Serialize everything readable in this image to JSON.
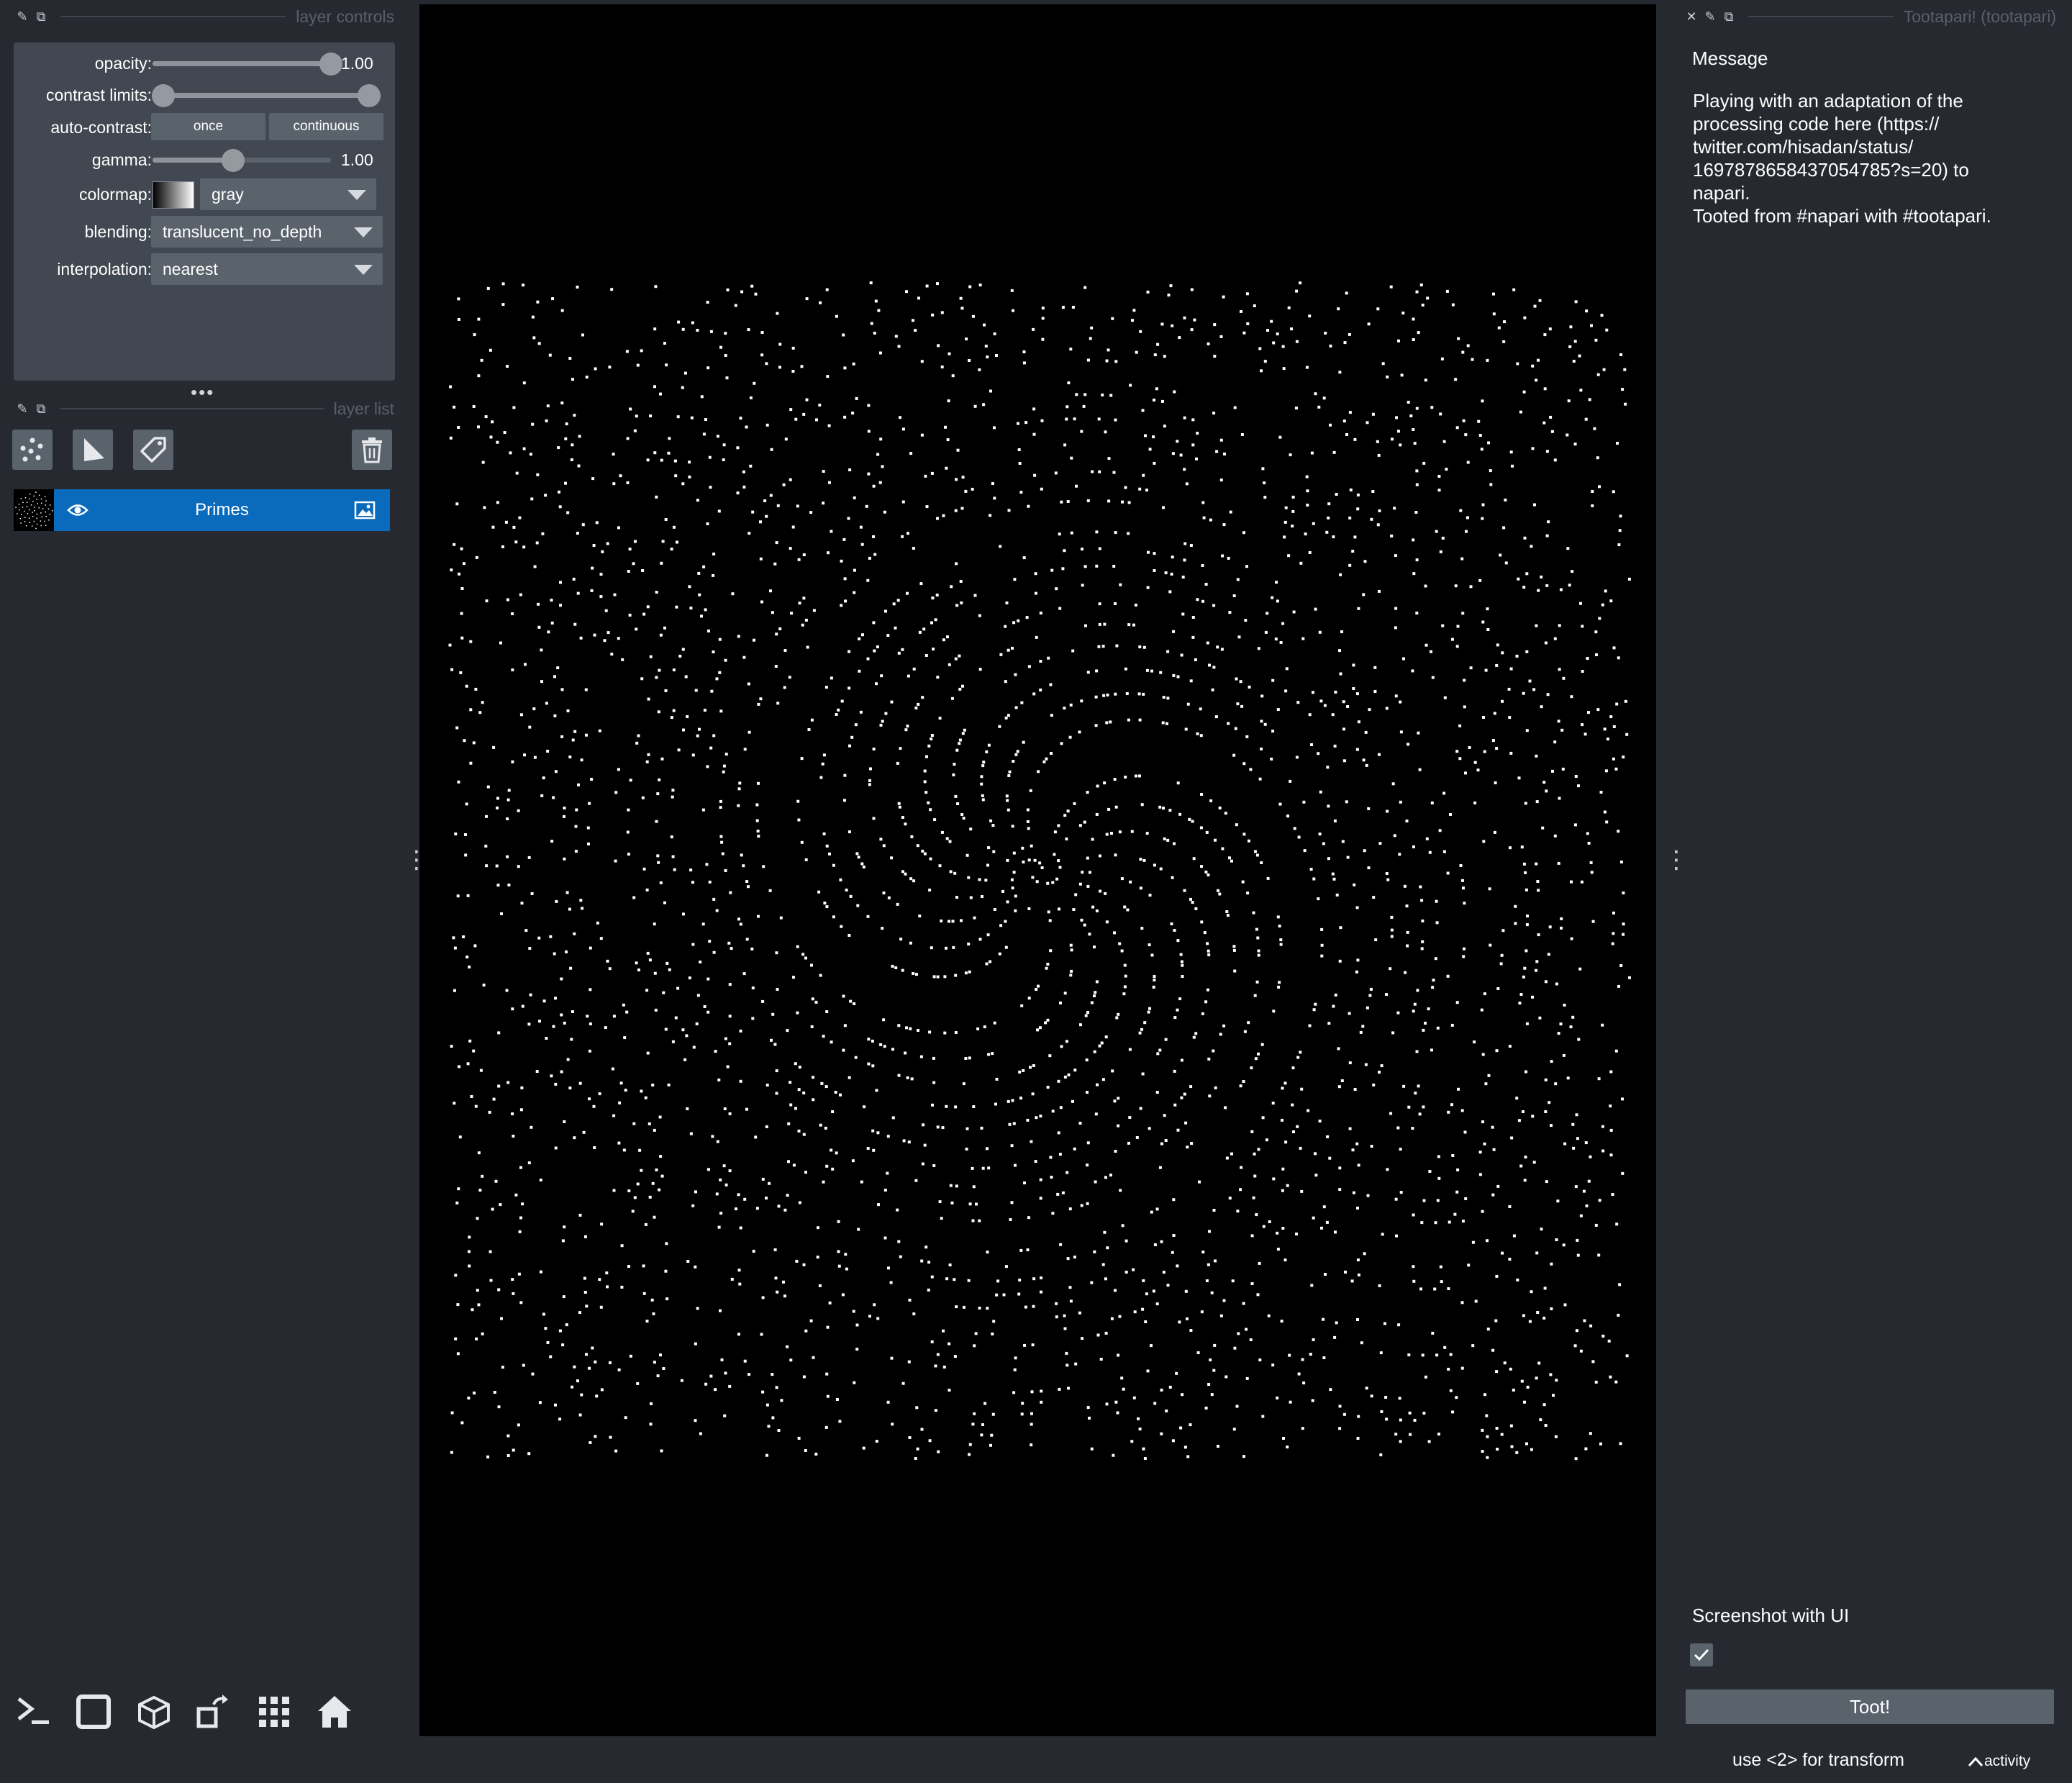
{
  "layer_controls": {
    "title": "layer controls",
    "opacity": {
      "label": "opacity:",
      "value": "1.00",
      "fraction": 1.0
    },
    "contrast_limits": {
      "label": "contrast limits:",
      "low_fraction": 0.0,
      "high_fraction": 1.0
    },
    "auto_contrast": {
      "label": "auto-contrast:",
      "once": "once",
      "continuous": "continuous"
    },
    "gamma": {
      "label": "gamma:",
      "value": "1.00",
      "fraction": 0.45
    },
    "colormap": {
      "label": "colormap:",
      "value": "gray"
    },
    "blending": {
      "label": "blending:",
      "value": "translucent_no_depth"
    },
    "interpolation": {
      "label": "interpolation:",
      "value": "nearest"
    }
  },
  "layer_list": {
    "title": "layer list",
    "tools": [
      "new-points-layer",
      "new-shapes-layer",
      "new-labels-layer",
      "delete-layer"
    ],
    "layers": [
      {
        "name": "Primes",
        "visible": true,
        "selected": true,
        "type": "image"
      }
    ]
  },
  "bottom_toolbar": [
    "console",
    "toggle-2d-3d",
    "roll-dimensions",
    "transpose-dimensions",
    "grid-mode",
    "home"
  ],
  "right_panel": {
    "title": "Tootapari! (tootapari)",
    "message_label": "Message",
    "message": "Playing with an adaptation of the\nprocessing code here (https://\ntwitter.com/hisadan/status/\n1697878658437054785?s=20) to\nnapari.\nTooted from #napari with #tootapari.",
    "screenshot_label": "Screenshot with UI",
    "screenshot_checked": true,
    "toot_button": "Toot!"
  },
  "status_bar": {
    "hint": "use <2> for transform",
    "activity": "activity"
  },
  "colors": {
    "background": "#262930",
    "panel": "#414851",
    "control": "#5a626c",
    "selected_layer": "#0a6bbd",
    "canvas": "#000000"
  }
}
